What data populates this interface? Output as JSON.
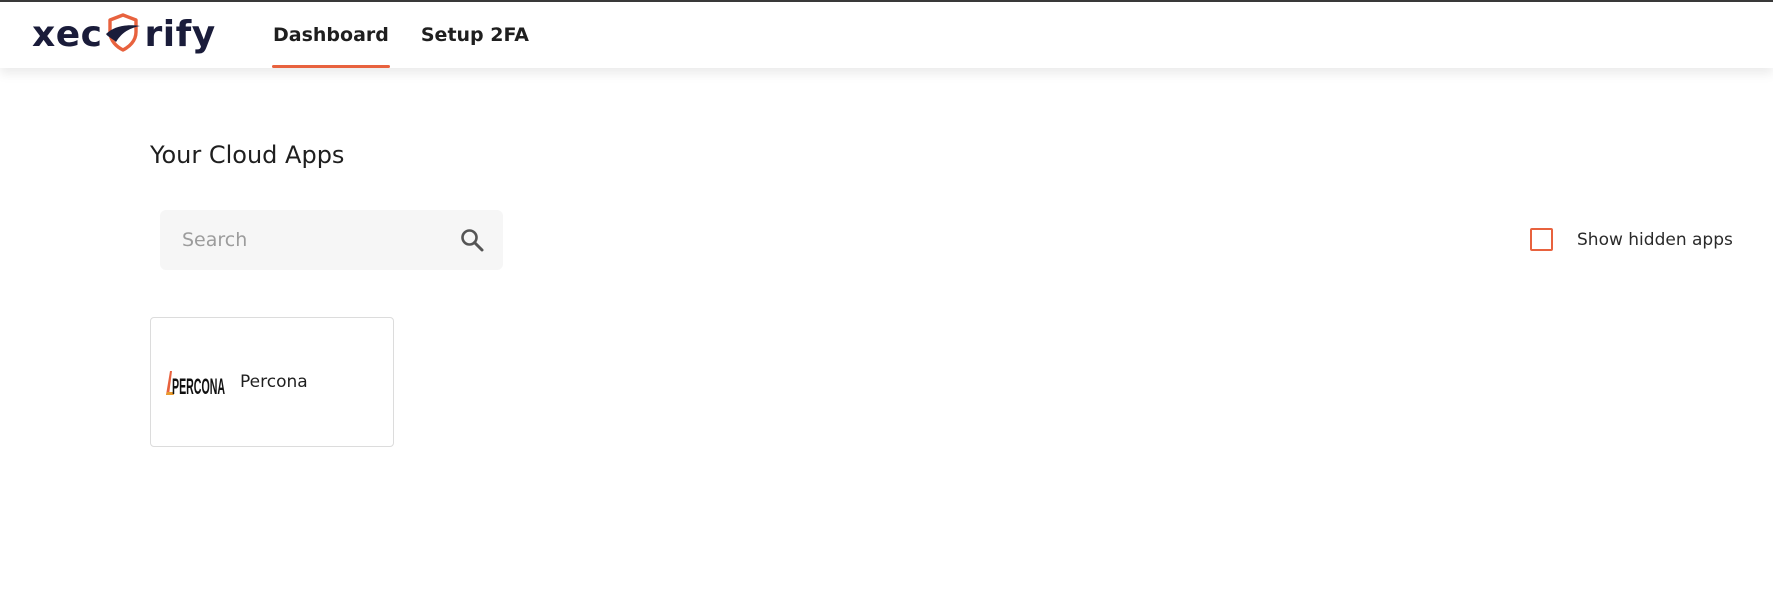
{
  "brand": {
    "logo_left": "xec",
    "logo_right": "rify",
    "accent_color": "#e8623e",
    "text_color": "#1a1c3a"
  },
  "nav": {
    "items": [
      {
        "label": "Dashboard",
        "active": true
      },
      {
        "label": "Setup 2FA",
        "active": false
      }
    ]
  },
  "main": {
    "title": "Your Cloud Apps",
    "search": {
      "placeholder": "Search",
      "value": "",
      "icon": "search-icon"
    },
    "show_hidden": {
      "label": "Show hidden apps",
      "checked": false
    },
    "apps": [
      {
        "name": "Percona",
        "logo_text": "PERCONA",
        "icon": "percona-logo"
      }
    ]
  }
}
